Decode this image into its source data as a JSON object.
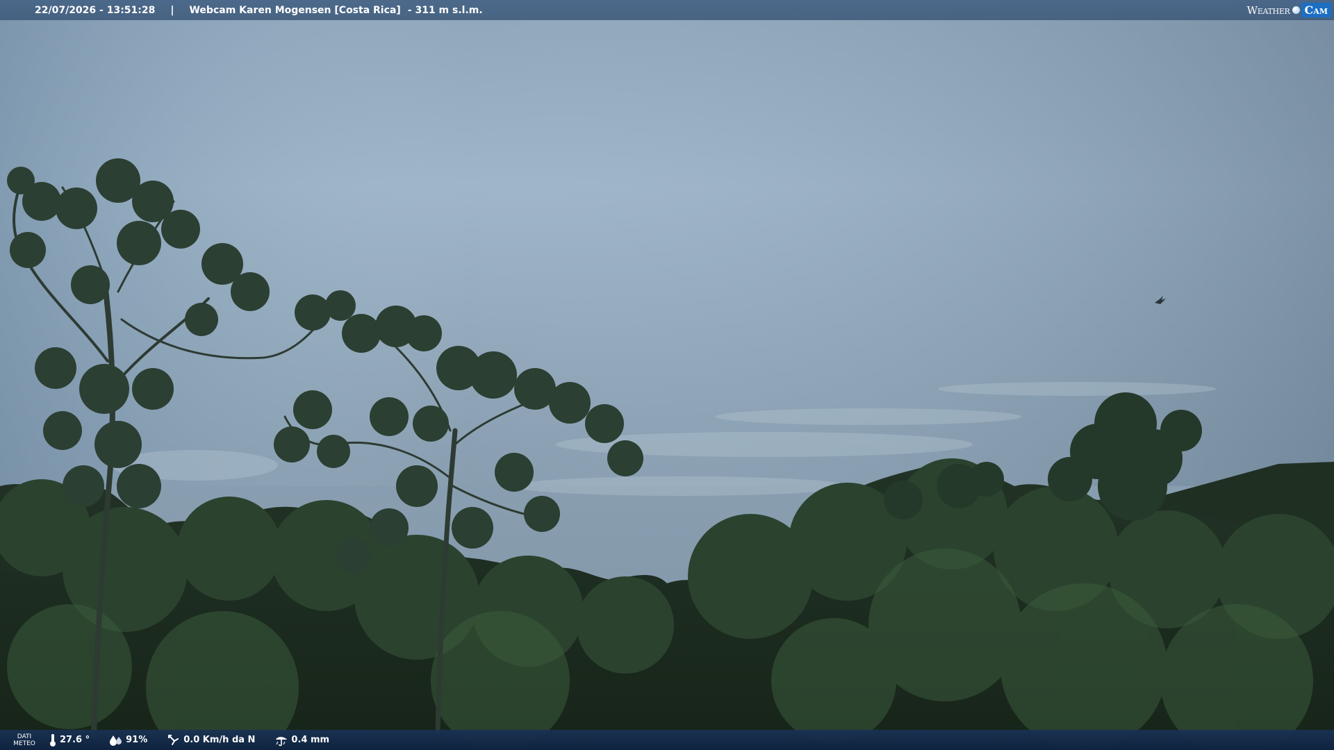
{
  "header": {
    "timestamp": "22/07/2026 - 13:51:28",
    "separator": "|",
    "title": "Webcam Karen Mogensen [Costa Rica]",
    "altitude": "- 311 m s.l.m."
  },
  "brand": {
    "weather": "Weather",
    "cam": "Cam",
    "accent_color": "#1d6fc4"
  },
  "weather_bar": {
    "label_line1": "DATI",
    "label_line2": "METEO",
    "temperature": "27.6 °",
    "humidity": "91%",
    "wind": "0.0 Km/h da N",
    "rain": "0.4 mm",
    "icons": [
      "thermometer-icon",
      "humidity-icon",
      "wind-icon",
      "rain-icon"
    ]
  }
}
